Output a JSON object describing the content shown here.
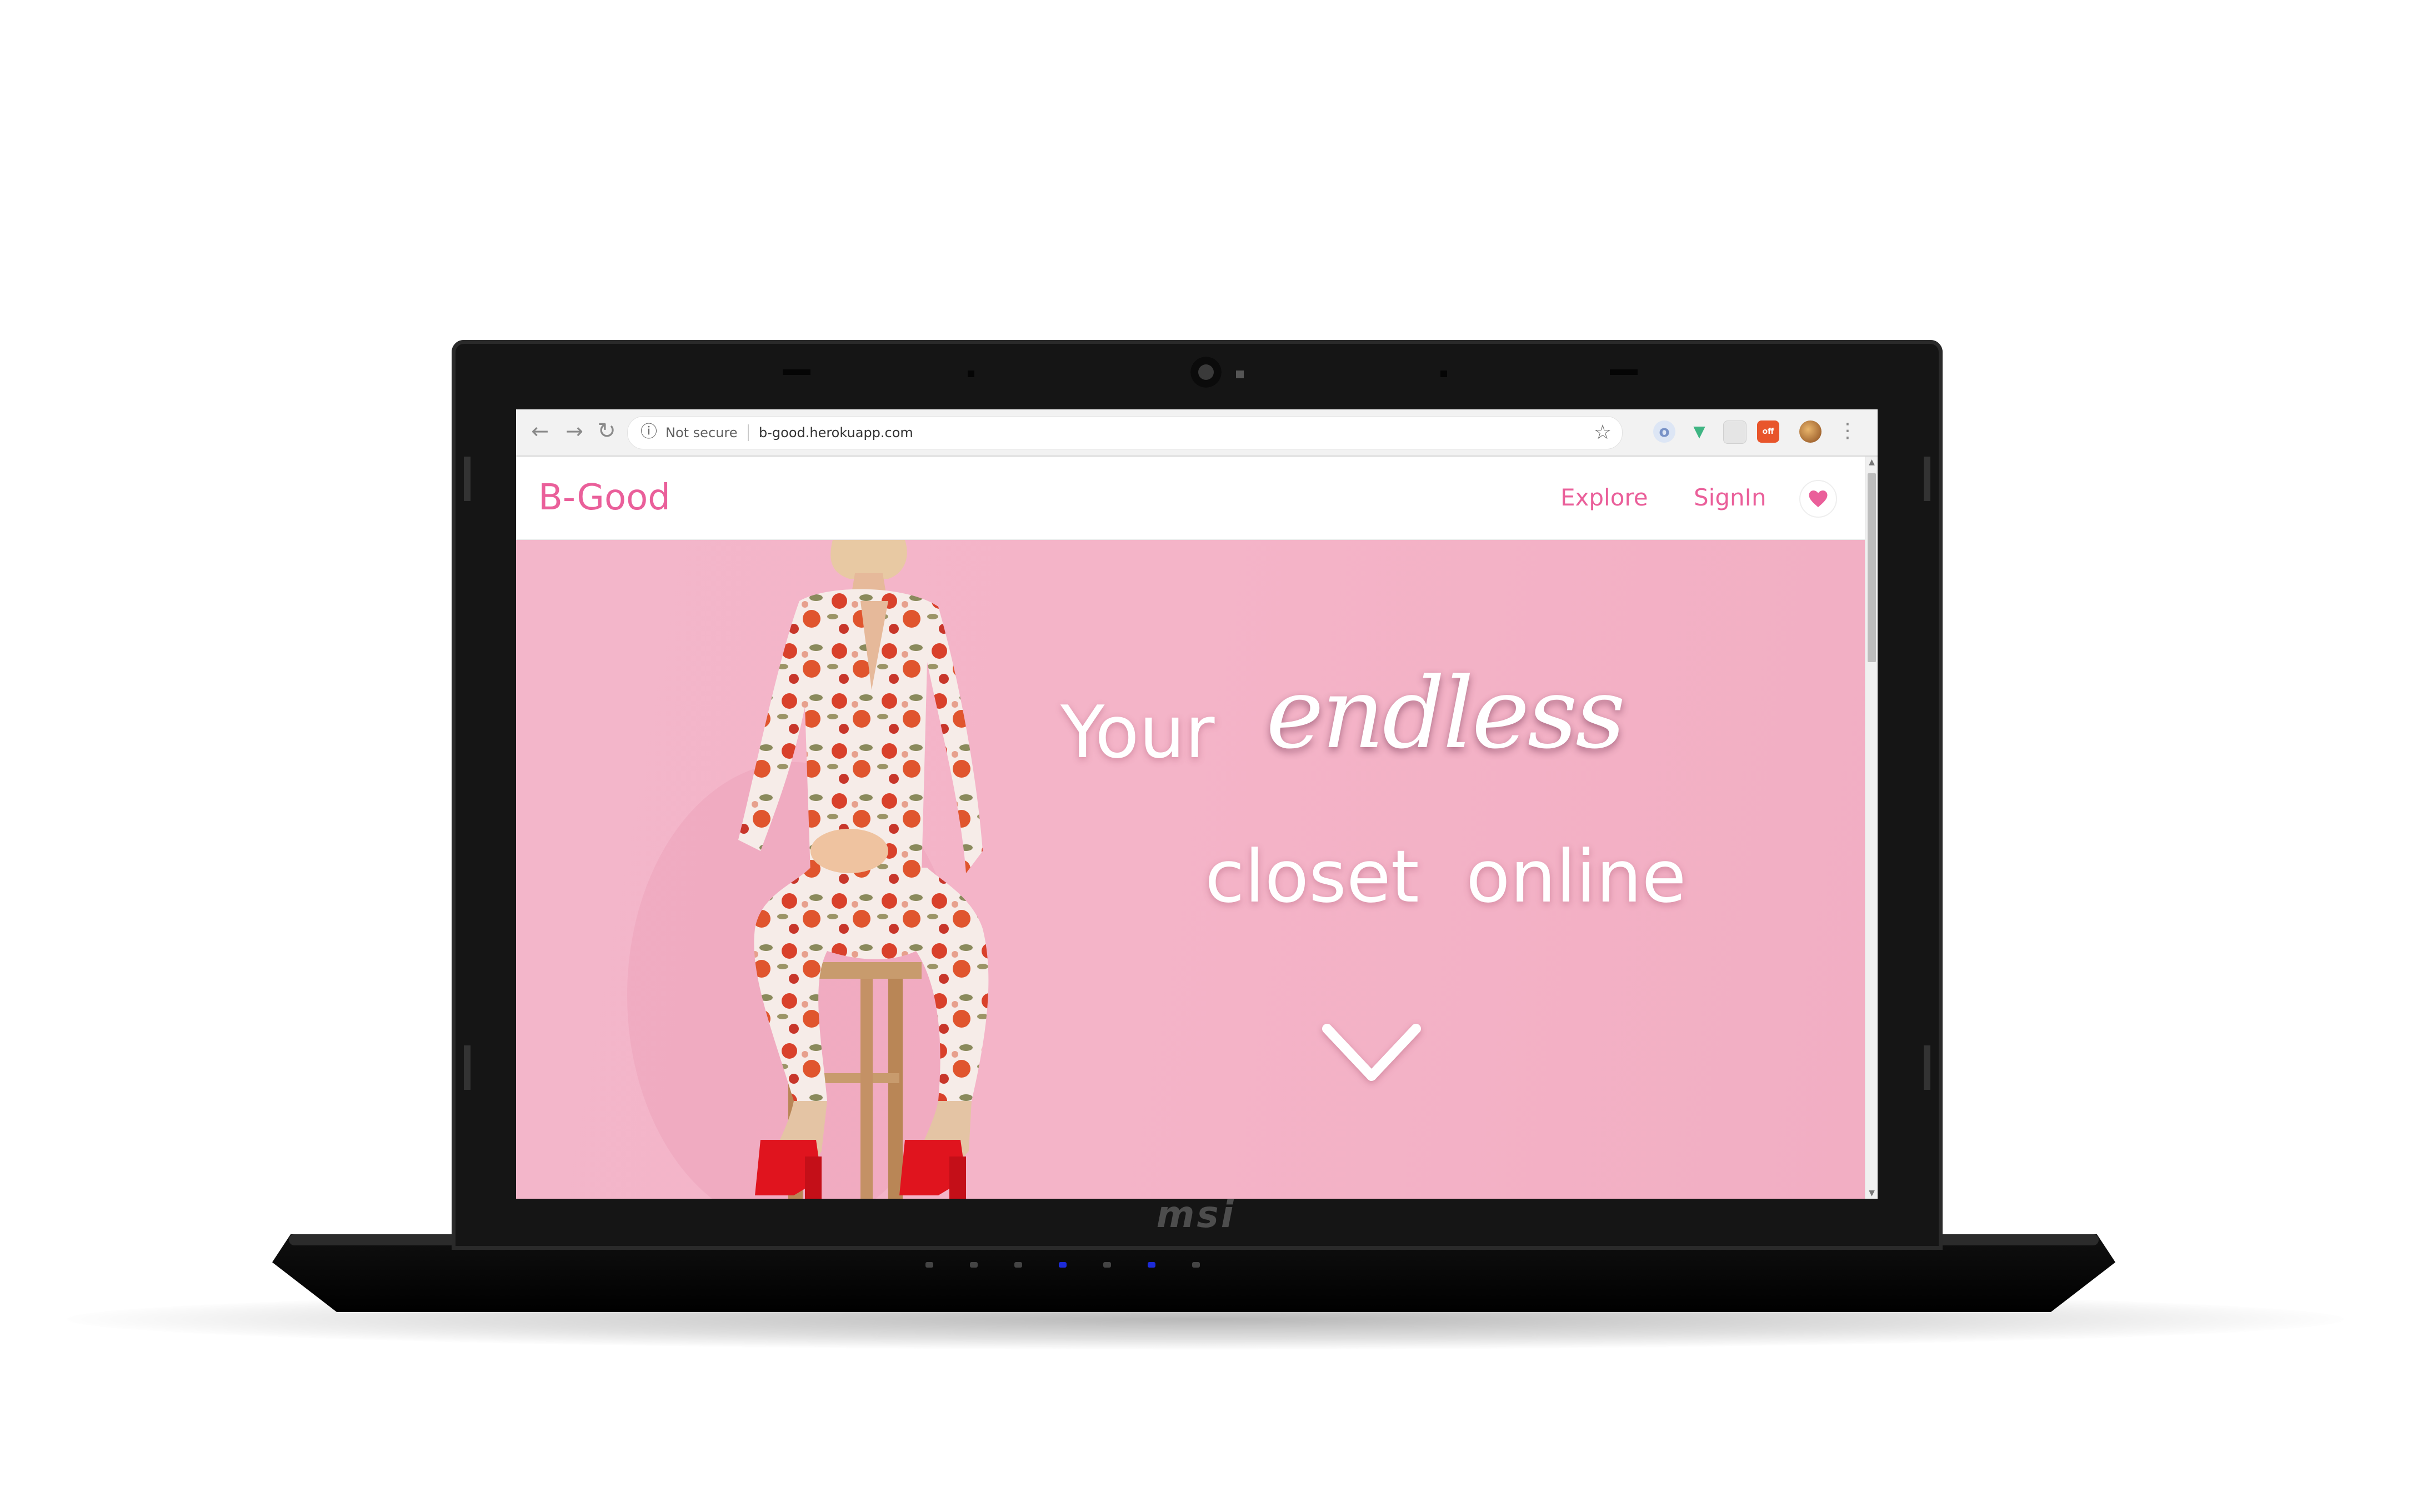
{
  "browser": {
    "back_icon": "arrow-left-icon",
    "forward_icon": "arrow-right-icon",
    "reload_icon": "reload-icon",
    "security_status": "Not secure",
    "url": "b-good.herokuapp.com",
    "bookmark_icon": "star-icon",
    "extensions": [
      "opera-extension-icon",
      "vue-devtools-icon",
      "blank-extension-icon",
      "adblock-off-icon",
      "profile-avatar-icon"
    ],
    "menu_icon": "kebab-menu-icon"
  },
  "site": {
    "logo": "B-Good",
    "nav": {
      "explore": "Explore",
      "signin": "SignIn"
    },
    "heart_color": "#ea5f9a",
    "brand_color": "#ea5f9a"
  },
  "hero": {
    "line1_word1": "Your",
    "line1_word2": "endless",
    "line2_word1": "closet",
    "line2_word2": "online",
    "background_color": "#f4b4c8",
    "scroll_icon": "chevron-down-icon"
  },
  "device": {
    "brand": "msi",
    "leds": [
      false,
      false,
      false,
      true,
      false,
      true,
      false
    ]
  }
}
